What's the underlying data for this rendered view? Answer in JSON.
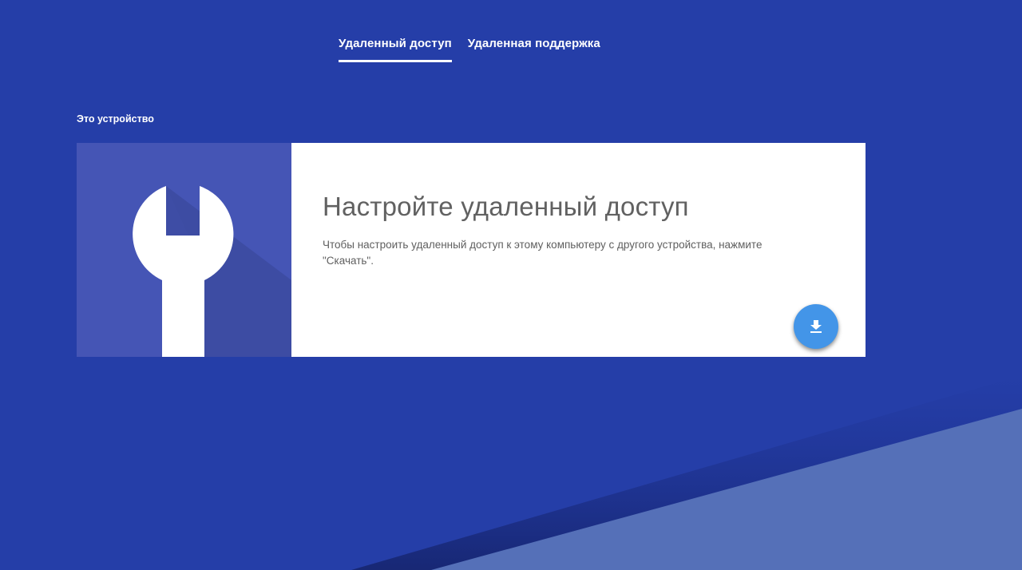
{
  "tabs": [
    {
      "label": "Удаленный доступ",
      "active": true
    },
    {
      "label": "Удаленная поддержка",
      "active": false
    }
  ],
  "section": {
    "label": "Это устройство"
  },
  "card": {
    "illustration_icon": "wrench-icon",
    "title": "Настройте удаленный доступ",
    "description": "Чтобы настроить удаленный доступ к этому компьютеру с другого устройства, нажмите \"Скачать\".",
    "download_icon": "download-icon"
  },
  "colors": {
    "background": "#253ea8",
    "illustration_bg": "#4555b5",
    "fab": "#4395e8",
    "title_text": "#616161"
  }
}
